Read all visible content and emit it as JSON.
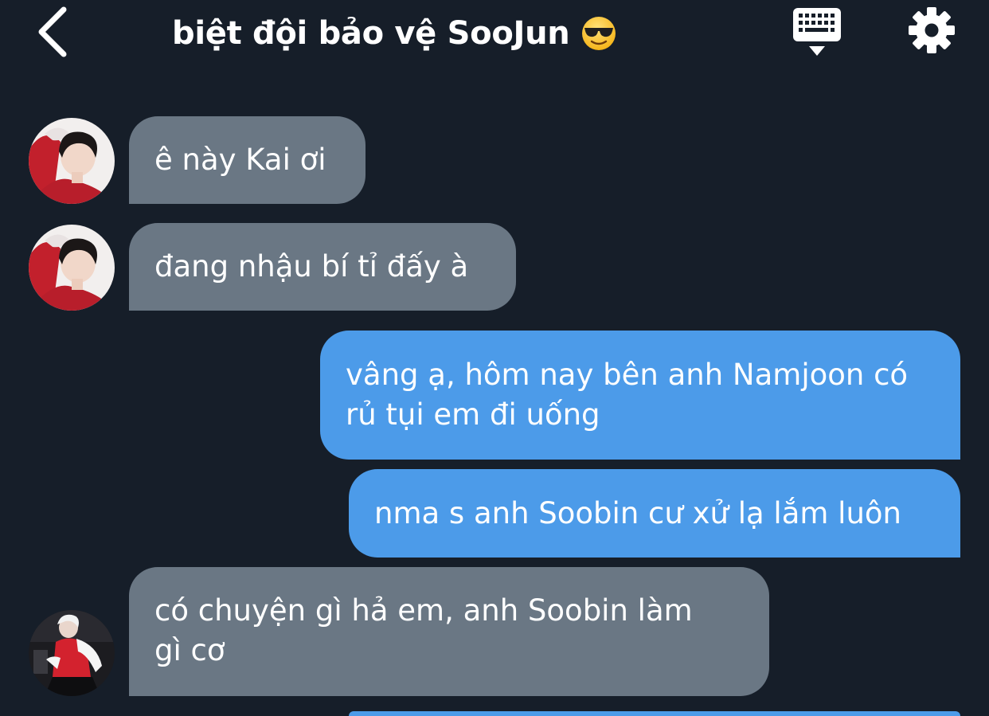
{
  "header": {
    "title": "biệt đội bảo vệ SooJun",
    "emoji": "smiling-face-with-sunglasses"
  },
  "icons": {
    "back": "chevron-left-icon",
    "keyboard": "keyboard-icon",
    "settings": "gear-icon"
  },
  "colors": {
    "background": "#161e29",
    "incoming_bubble": "#6a7784",
    "outgoing_bubble": "#4c9be9",
    "text": "#ffffff"
  },
  "messages": [
    {
      "direction": "in",
      "lines": [
        "ê này Kai ơi"
      ]
    },
    {
      "direction": "in",
      "lines": [
        "đang nhậu bí tỉ đấy à"
      ]
    },
    {
      "direction": "out",
      "lines": [
        "vâng ạ, hôm nay bên anh Namjoon có",
        "rủ tụi em đi uống"
      ]
    },
    {
      "direction": "out",
      "lines": [
        "nma s anh Soobin cư xử lạ lắm luôn"
      ]
    },
    {
      "direction": "in",
      "lines": [
        "có chuyện gì hả em, anh Soobin làm",
        "gì cơ"
      ]
    }
  ]
}
